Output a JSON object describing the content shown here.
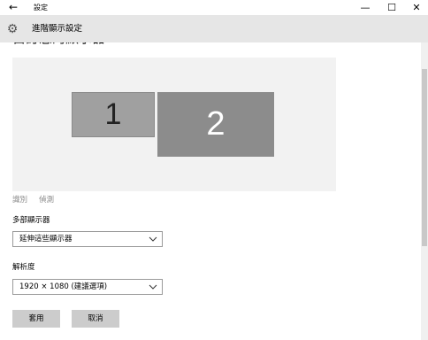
{
  "titlebar": {
    "back_icon": "←",
    "app_title": "設定",
    "minimize_icon": "—",
    "maximize_icon": "☐",
    "close_icon": "✕"
  },
  "header": {
    "gear_icon": "⚙",
    "page_title": "進階顯示設定"
  },
  "main": {
    "section_title": "自訂您的顯示器",
    "monitors": [
      {
        "label": "1"
      },
      {
        "label": "2"
      }
    ],
    "identify_link": "識別",
    "detect_link": "偵測",
    "multiple_displays": {
      "label": "多部顯示器",
      "value": "延伸這些顯示器"
    },
    "resolution": {
      "label": "解析度",
      "value": "1920 × 1080 (建議選項)"
    },
    "apply_button": "套用",
    "cancel_button": "取消"
  },
  "colors": {
    "header_bg": "#e6e6e6",
    "display_area_bg": "#f2f2f2",
    "monitor_1": "#a0a0a0",
    "monitor_2": "#8c8c8c",
    "button_bg": "#cccccc"
  }
}
